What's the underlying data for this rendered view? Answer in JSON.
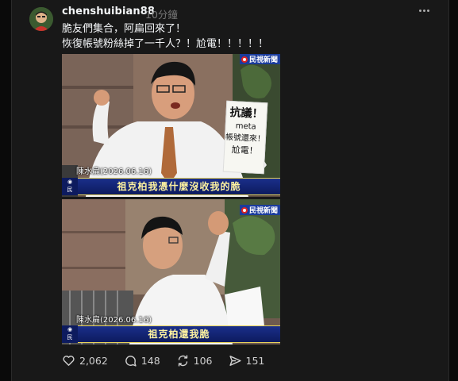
{
  "post": {
    "username": "chenshuibian88",
    "time": "10分鐘",
    "text_line1": "脆友們集合，阿扁回來了！",
    "text_line2": "恢復帳號粉絲掉了一千人？！尬電！！！！！"
  },
  "media": [
    {
      "logo": "民視新聞",
      "name_tag": "陳水扁(2026.06.16)",
      "banner": "祖克柏我憑什麼沒收我的脆",
      "sign": [
        "抗議！",
        "meta",
        "帳號還來！",
        "尬電！"
      ]
    },
    {
      "logo": "民視新聞",
      "name_tag": "陳水扁(2026.06.16)",
      "banner": "祖克柏還我脆"
    }
  ],
  "actions": {
    "likes": "2,062",
    "replies": "148",
    "reposts": "106",
    "shares": "151"
  },
  "icons": [
    "more-icon",
    "heart-icon",
    "reply-icon",
    "repost-icon",
    "share-icon"
  ],
  "colors": {
    "background": "#181818",
    "page": "#0a0a0a",
    "banner": "#1a2f8a",
    "banner_text": "#fff3a0"
  }
}
